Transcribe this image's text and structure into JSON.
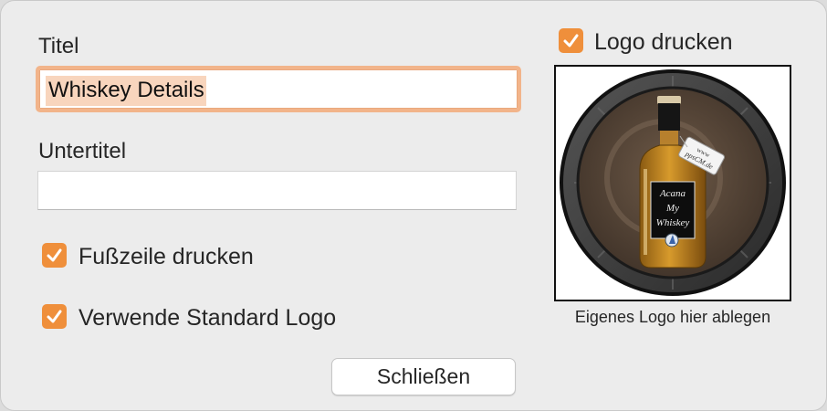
{
  "title_label": "Titel",
  "title_value": "Whiskey Details",
  "subtitle_label": "Untertitel",
  "subtitle_value": "",
  "footer_checkbox": {
    "label": "Fußzeile drucken",
    "checked": true
  },
  "standard_logo_checkbox": {
    "label": "Verwende Standard Logo",
    "checked": true
  },
  "print_logo_checkbox": {
    "label": "Logo drucken",
    "checked": true
  },
  "close_button": "Schließen",
  "logo_caption": "Eigenes Logo hier ablegen",
  "logo_image": {
    "bottle_label_lines": [
      "Acana",
      "My",
      "Whiskey"
    ],
    "tag_lines": [
      "www",
      "ppsCM.de"
    ]
  },
  "colors": {
    "accent": "#ef8f3b",
    "focus_ring": "#f2b48a",
    "selection": "#f8d5bd",
    "background": "#ececec"
  }
}
